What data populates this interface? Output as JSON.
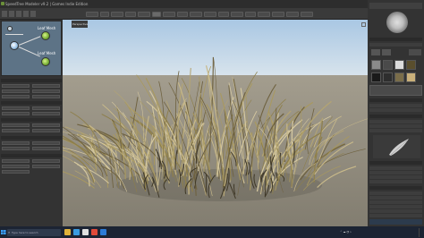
{
  "titlebar": {
    "title": "SpeedTree Modeler v9.2 | Games Indie Edition"
  },
  "toolbar": {
    "buttons": [
      "",
      "",
      "",
      "",
      "",
      "",
      "",
      "",
      "",
      "",
      "",
      "",
      "",
      "",
      "",
      "",
      ""
    ]
  },
  "generators": {
    "leaf_mesh_1": "Leaf Mesh",
    "leaf_mesh_2": "Leaf Mesh"
  },
  "viewport": {
    "tab_label": "Perspective"
  },
  "taskbar": {
    "search_placeholder": "Type here to search",
    "items": [
      "",
      "",
      "",
      "",
      "",
      "",
      "",
      "",
      ""
    ]
  },
  "colors": {
    "sky": "#b9d3ea",
    "ground": "#8f8a7c",
    "grass": "#9b8c5c",
    "panel": "#333333",
    "taskbar": "#1c2433"
  }
}
